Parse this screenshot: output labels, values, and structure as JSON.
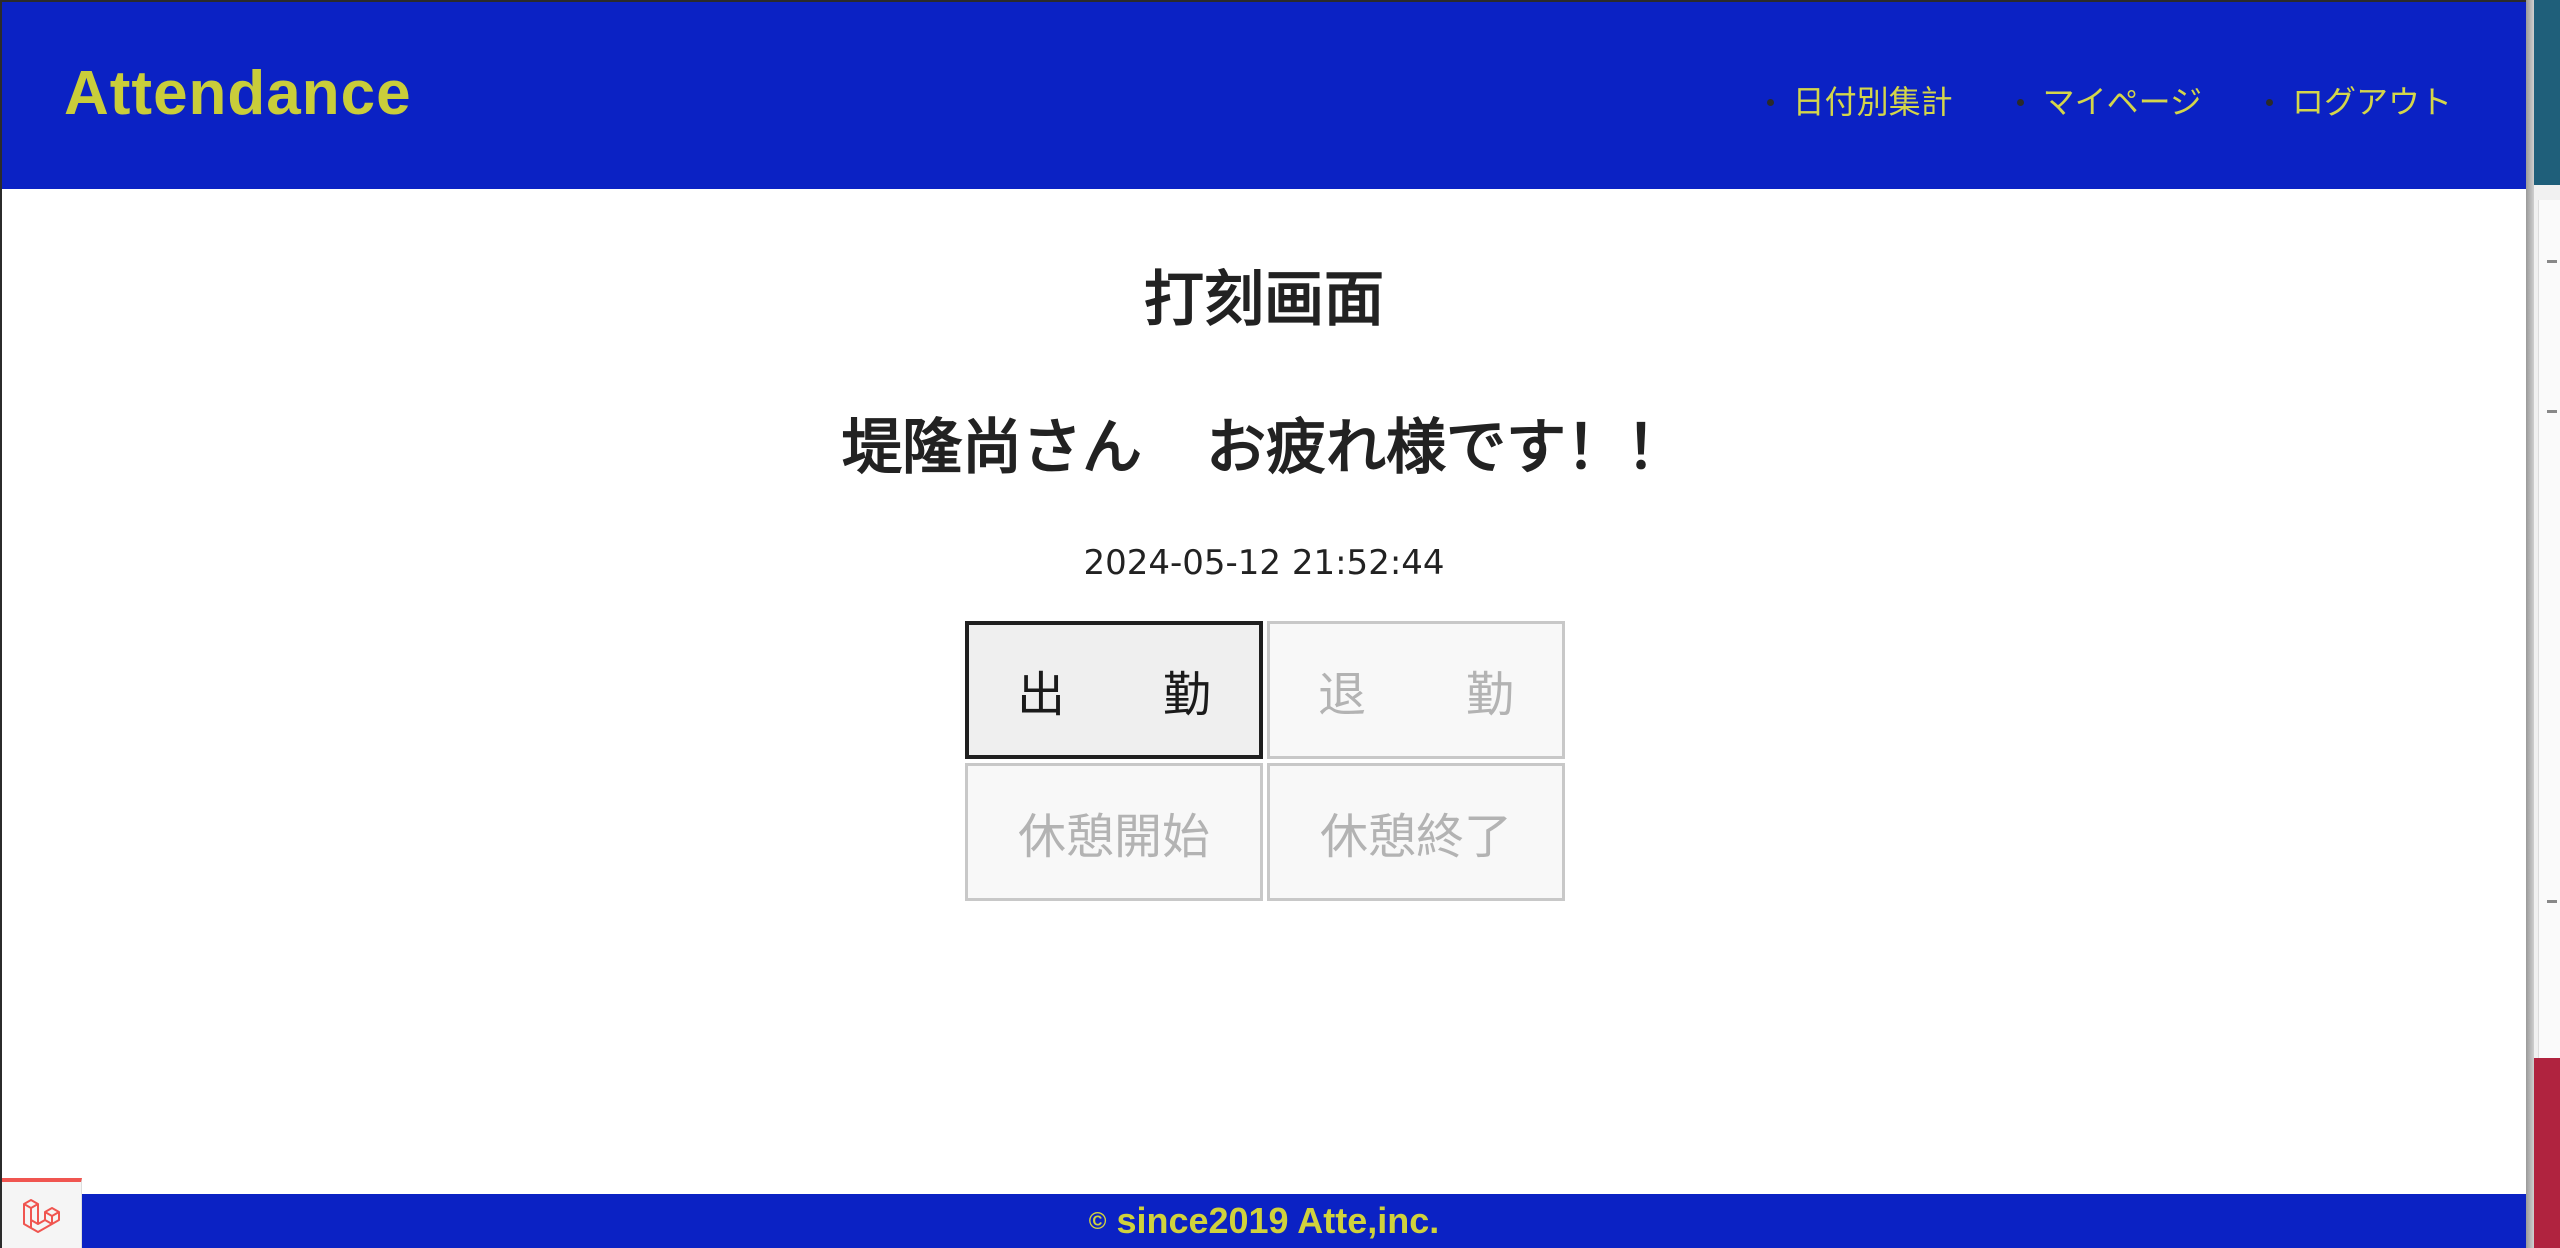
{
  "header": {
    "logo": "Attendance",
    "nav": [
      {
        "label": "日付別集計"
      },
      {
        "label": "マイページ"
      },
      {
        "label": "ログアウト"
      }
    ]
  },
  "main": {
    "title": "打刻画面",
    "greeting_name": "堤隆尚さん",
    "greeting_message": "お疲れ様です！！",
    "datetime": "2024-05-12 21:52:44",
    "buttons": {
      "clock_in": {
        "left": "出",
        "right": "勤",
        "enabled": true
      },
      "clock_out": {
        "left": "退",
        "right": "勤",
        "enabled": false
      },
      "break_start": {
        "label": "休憩開始",
        "enabled": false
      },
      "break_end": {
        "label": "休憩終了",
        "enabled": false
      }
    }
  },
  "footer": {
    "copyright_symbol": "©",
    "text": "since2019 Atte,inc."
  },
  "colors": {
    "header_bg": "#0b22c4",
    "accent_text": "#c9cd3a",
    "active_button_border": "#1f1f1f",
    "disabled_button_text": "#b3b3b3"
  },
  "icons": {
    "debugbar": "laravel-icon"
  }
}
